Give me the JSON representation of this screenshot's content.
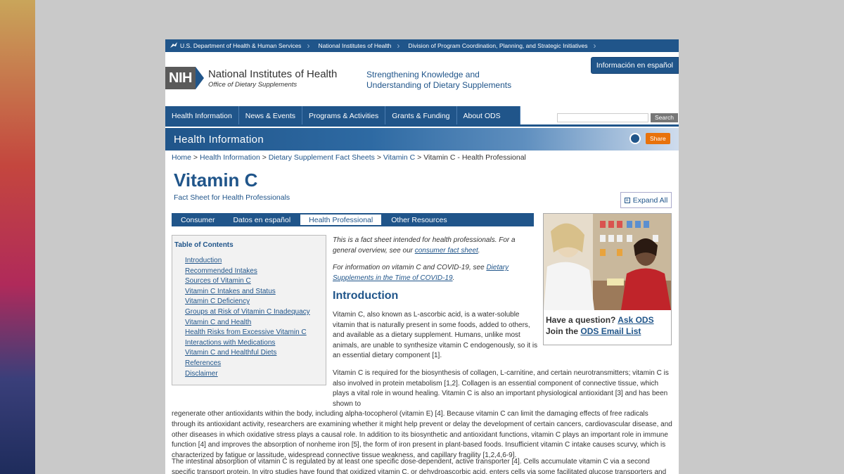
{
  "govbar": {
    "items": [
      "U.S. Department of Health & Human Services",
      "National Institutes of Health",
      "Division of Program Coordination, Planning, and Strategic Initiatives"
    ]
  },
  "header": {
    "nih_abbr": "NIH",
    "org_name": "National Institutes of Health",
    "office": "Office of Dietary Supplements",
    "tagline_line1": "Strengthening Knowledge and",
    "tagline_line2": "Understanding of Dietary Supplements",
    "espanol": "Información en español"
  },
  "nav": {
    "items": [
      "Health Information",
      "News & Events",
      "Programs & Activities",
      "Grants & Funding",
      "About ODS"
    ],
    "search_label": "Search"
  },
  "banner": {
    "title": "Health Information",
    "share": "Share"
  },
  "breadcrumb": {
    "home": "Home",
    "health_info": "Health Information",
    "fact_sheets": "Dietary Supplement Fact Sheets",
    "vitamin_c": "Vitamin C",
    "current": "Vitamin C - Health Professional"
  },
  "page": {
    "title": "Vitamin C",
    "subtitle": "Fact Sheet for Health Professionals",
    "expand_all": "Expand All"
  },
  "tabs": [
    "Consumer",
    "Datos en español",
    "Health Professional",
    "Other Resources"
  ],
  "toc": {
    "title": "Table of Contents",
    "items": [
      "Introduction",
      "Recommended Intakes",
      "Sources of Vitamin C",
      "Vitamin C Intakes and Status",
      "Vitamin C Deficiency",
      "Groups at Risk of Vitamin C Inadequacy",
      "Vitamin C and Health",
      "Health Risks from Excessive Vitamin C",
      "Interactions with Medications",
      "Vitamin C and Healthful Diets",
      "References",
      "Disclaimer"
    ]
  },
  "notes": {
    "intro_a": "This is a fact sheet intended for health professionals. For a general overview, see our ",
    "intro_link": "consumer fact sheet",
    "intro_b": ".",
    "covid_a": "For information on vitamin C and COVID-19, see ",
    "covid_link": "Dietary Supplements in the Time of COVID-19",
    "covid_b": "."
  },
  "intro_heading": "Introduction",
  "para1": "Vitamin C, also known as L-ascorbic acid, is a water-soluble vitamin that is naturally present in some foods, added to others, and available as a dietary supplement. Humans, unlike most animals, are unable to synthesize vitamin C endogenously, so it is an essential dietary component [1].",
  "para2_start": "Vitamin C is required for the biosynthesis of collagen, L-carnitine, and certain neurotransmitters; vitamin C is also involved in protein metabolism [1,2]. Collagen is an essential component of connective tissue, which plays a vital role in wound healing. Vitamin C is also an important physiological antioxidant [3] and has been shown to",
  "para2_rest": "regenerate other antioxidants within the body, including alpha-tocopherol (vitamin E) [4]. Because vitamin C can limit the damaging effects of free radicals through its antioxidant activity, researchers are examining whether it might help prevent or delay the development of certain cancers, cardiovascular disease, and other diseases in which oxidative stress plays a causal role. In addition to its biosynthetic and antioxidant functions, vitamin C plays an important role in immune function [4] and improves the absorption of nonheme iron [5], the form of iron present in plant-based foods. Insufficient vitamin C intake causes scurvy, which is characterized by fatigue or lassitude, widespread connective tissue weakness, and capillary fragility [1,2,4,6-9].",
  "para3": "The intestinal absorption of vitamin C is regulated by at least one specific dose-dependent, active transporter [4]. Cells accumulate vitamin C via a second specific transport protein. In vitro studies have found that oxidized vitamin C, or dehydroascorbic acid, enters cells via some facilitated glucose transporters and is then",
  "photo_card": {
    "q": "Have a question?",
    "ask": "Ask ODS",
    "join": "Join the",
    "email": "ODS Email List"
  }
}
